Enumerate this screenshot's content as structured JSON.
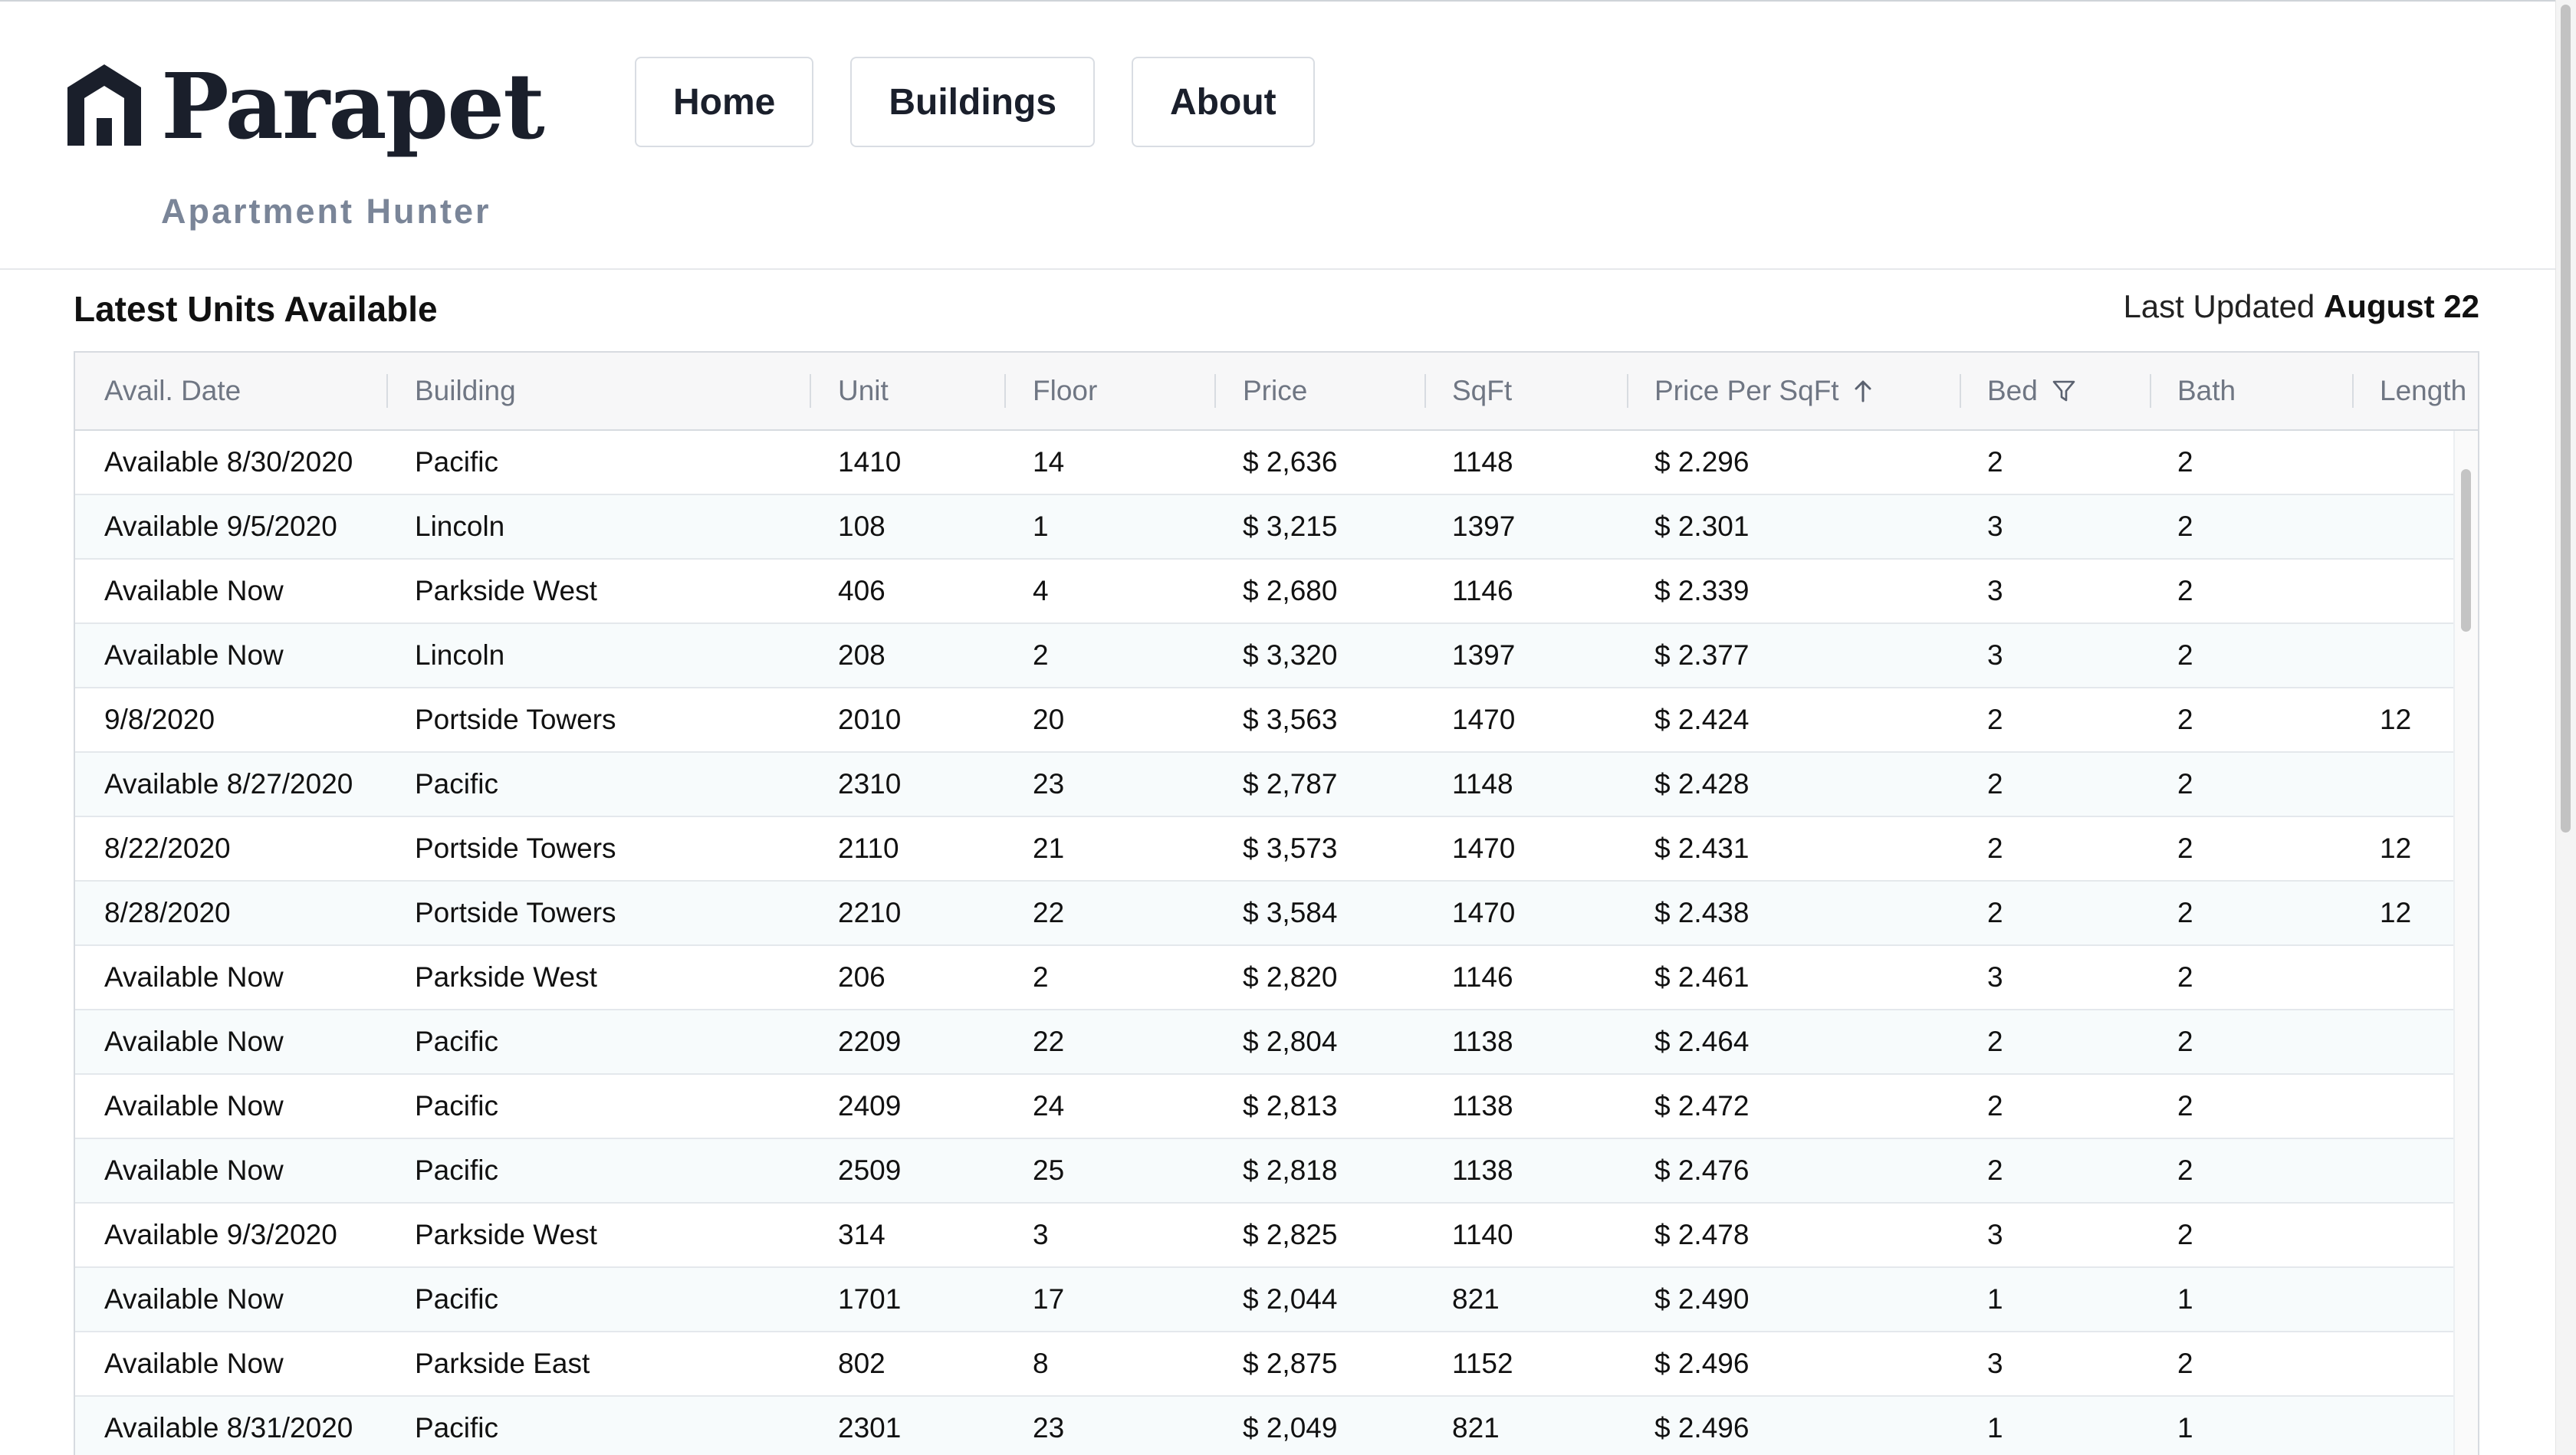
{
  "brand": {
    "name": "Parapet",
    "tagline": "Apartment Hunter"
  },
  "nav": [
    {
      "label": "Home"
    },
    {
      "label": "Buildings"
    },
    {
      "label": "About"
    }
  ],
  "section": {
    "title": "Latest Units Available",
    "updated_prefix": "Last Updated",
    "updated_date": "August 22"
  },
  "columns": [
    {
      "key": "avail",
      "label": "Avail. Date"
    },
    {
      "key": "building",
      "label": "Building"
    },
    {
      "key": "unit",
      "label": "Unit"
    },
    {
      "key": "floor",
      "label": "Floor"
    },
    {
      "key": "price",
      "label": "Price"
    },
    {
      "key": "sqft",
      "label": "SqFt"
    },
    {
      "key": "ppsf",
      "label": "Price Per SqFt",
      "icon": "sort-ascending-icon"
    },
    {
      "key": "bed",
      "label": "Bed",
      "icon": "filter-icon"
    },
    {
      "key": "bath",
      "label": "Bath"
    },
    {
      "key": "length",
      "label": "Length"
    }
  ],
  "rows": [
    [
      "Available 8/30/2020",
      "Pacific",
      "1410",
      "14",
      "$ 2,636",
      "1148",
      "$ 2.296",
      "2",
      "2",
      ""
    ],
    [
      "Available 9/5/2020",
      "Lincoln",
      "108",
      "1",
      "$ 3,215",
      "1397",
      "$ 2.301",
      "3",
      "2",
      ""
    ],
    [
      "Available Now",
      "Parkside West",
      "406",
      "4",
      "$ 2,680",
      "1146",
      "$ 2.339",
      "3",
      "2",
      ""
    ],
    [
      "Available Now",
      "Lincoln",
      "208",
      "2",
      "$ 3,320",
      "1397",
      "$ 2.377",
      "3",
      "2",
      ""
    ],
    [
      "9/8/2020",
      "Portside Towers",
      "2010",
      "20",
      "$ 3,563",
      "1470",
      "$ 2.424",
      "2",
      "2",
      "12"
    ],
    [
      "Available 8/27/2020",
      "Pacific",
      "2310",
      "23",
      "$ 2,787",
      "1148",
      "$ 2.428",
      "2",
      "2",
      ""
    ],
    [
      "8/22/2020",
      "Portside Towers",
      "2110",
      "21",
      "$ 3,573",
      "1470",
      "$ 2.431",
      "2",
      "2",
      "12"
    ],
    [
      "8/28/2020",
      "Portside Towers",
      "2210",
      "22",
      "$ 3,584",
      "1470",
      "$ 2.438",
      "2",
      "2",
      "12"
    ],
    [
      "Available Now",
      "Parkside West",
      "206",
      "2",
      "$ 2,820",
      "1146",
      "$ 2.461",
      "3",
      "2",
      ""
    ],
    [
      "Available Now",
      "Pacific",
      "2209",
      "22",
      "$ 2,804",
      "1138",
      "$ 2.464",
      "2",
      "2",
      ""
    ],
    [
      "Available Now",
      "Pacific",
      "2409",
      "24",
      "$ 2,813",
      "1138",
      "$ 2.472",
      "2",
      "2",
      ""
    ],
    [
      "Available Now",
      "Pacific",
      "2509",
      "25",
      "$ 2,818",
      "1138",
      "$ 2.476",
      "2",
      "2",
      ""
    ],
    [
      "Available 9/3/2020",
      "Parkside West",
      "314",
      "3",
      "$ 2,825",
      "1140",
      "$ 2.478",
      "3",
      "2",
      ""
    ],
    [
      "Available Now",
      "Pacific",
      "1701",
      "17",
      "$ 2,044",
      "821",
      "$ 2.490",
      "1",
      "1",
      ""
    ],
    [
      "Available Now",
      "Parkside East",
      "802",
      "8",
      "$ 2,875",
      "1152",
      "$ 2.496",
      "3",
      "2",
      ""
    ],
    [
      "Available 8/31/2020",
      "Pacific",
      "2301",
      "23",
      "$ 2,049",
      "821",
      "$ 2.496",
      "1",
      "1",
      ""
    ]
  ]
}
